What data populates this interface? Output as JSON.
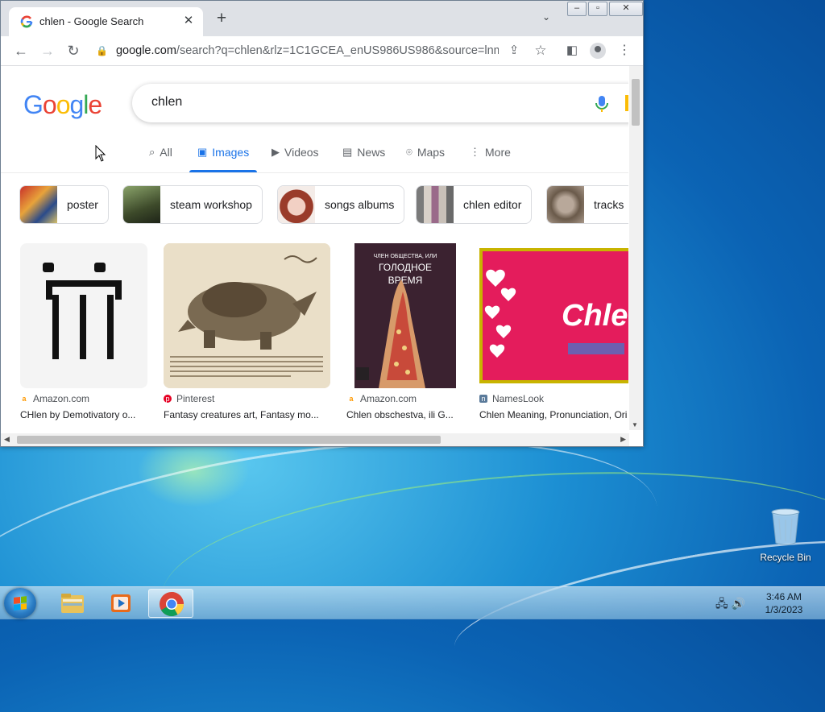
{
  "browser": {
    "tab_title": "chlen - Google Search",
    "url_host": "google.com",
    "url_path": "/search?q=chlen&rlz=1C1GCEA_enUS986US986&source=lnms..."
  },
  "search": {
    "logo": "Google",
    "query": "chlen"
  },
  "nav_tabs": [
    {
      "label": "All",
      "icon": "search-icon"
    },
    {
      "label": "Images",
      "icon": "image-icon",
      "active": true
    },
    {
      "label": "Videos",
      "icon": "video-icon"
    },
    {
      "label": "News",
      "icon": "news-icon"
    },
    {
      "label": "Maps",
      "icon": "map-pin-icon"
    },
    {
      "label": "More",
      "icon": "more-vert-icon"
    }
  ],
  "chips": [
    {
      "label": "poster"
    },
    {
      "label": "steam workshop"
    },
    {
      "label": "songs albums"
    },
    {
      "label": "chlen editor"
    },
    {
      "label": "tracks"
    }
  ],
  "results": [
    {
      "source": "Amazon.com",
      "caption": "CHlen by Demotivatory o..."
    },
    {
      "source": "Pinterest",
      "caption": "Fantasy creatures art, Fantasy mo..."
    },
    {
      "source": "Amazon.com",
      "caption": "Chlen obschestva, ili G...",
      "book_text": {
        "line1": "ЧЛЕН ОБЩЕСТВА, ИЛИ",
        "line2": "ГОЛОДНОЕ",
        "line3": "ВРЕМЯ"
      }
    },
    {
      "source": "NamesLook",
      "caption": "Chlen Meaning, Pronunciation, Ori",
      "image_text": "Chlen"
    }
  ],
  "desktop": {
    "recycle_bin": "Recycle Bin"
  },
  "taskbar": {
    "time": "3:46 AM",
    "date": "1/3/2023"
  },
  "colors": {
    "google_blue": "#4285f4",
    "google_red": "#ea4335",
    "google_yellow": "#fbbc05",
    "google_green": "#34a853",
    "active_tab": "#1a73e8"
  }
}
